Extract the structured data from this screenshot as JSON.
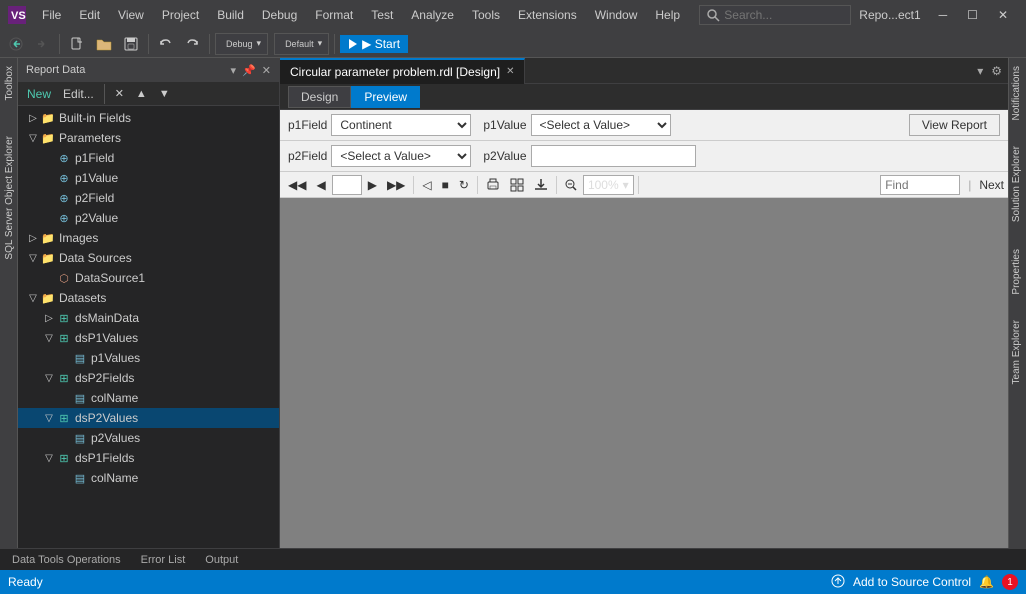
{
  "title_bar": {
    "logo_label": "VS",
    "menu_items": [
      "File",
      "Edit",
      "View",
      "Project",
      "Build",
      "Debug",
      "Format",
      "Test",
      "Analyze",
      "Tools",
      "Extensions",
      "Window",
      "Help"
    ],
    "search_placeholder": "Search...",
    "repo_label": "Repo...ect1",
    "window_controls": [
      "─",
      "☐",
      "✕"
    ]
  },
  "toolbar": {
    "back_btn": "◀",
    "forward_btn": "▶",
    "debug_label": "Debug",
    "platform_label": "Default",
    "start_btn": "▶ Start",
    "undo_btn": "↩",
    "redo_btn": "↪"
  },
  "sidebar": {
    "title": "Report Data",
    "header_pins": [
      "▾",
      "📌",
      "─"
    ],
    "toolbar_btns": [
      "New",
      "Edit...",
      "✕",
      "▲",
      "▼"
    ],
    "tree": [
      {
        "id": "built-in",
        "label": "Built-in Fields",
        "level": 0,
        "expand": "▷",
        "icon": "folder",
        "type": "folder"
      },
      {
        "id": "parameters",
        "label": "Parameters",
        "level": 0,
        "expand": "▽",
        "icon": "folder",
        "type": "folder"
      },
      {
        "id": "p1field",
        "label": "p1Field",
        "level": 1,
        "expand": "",
        "icon": "param",
        "type": "param"
      },
      {
        "id": "p1value",
        "label": "p1Value",
        "level": 1,
        "expand": "",
        "icon": "param",
        "type": "param"
      },
      {
        "id": "p2field",
        "label": "p2Field",
        "level": 1,
        "expand": "",
        "icon": "param",
        "type": "param"
      },
      {
        "id": "p2value",
        "label": "p2Value",
        "level": 1,
        "expand": "",
        "icon": "param",
        "type": "param"
      },
      {
        "id": "images",
        "label": "Images",
        "level": 0,
        "expand": "▷",
        "icon": "folder",
        "type": "folder"
      },
      {
        "id": "datasources",
        "label": "Data Sources",
        "level": 0,
        "expand": "▽",
        "icon": "folder",
        "type": "folder"
      },
      {
        "id": "datasource1",
        "label": "DataSource1",
        "level": 1,
        "expand": "",
        "icon": "datasource",
        "type": "datasource"
      },
      {
        "id": "datasets",
        "label": "Datasets",
        "level": 0,
        "expand": "▽",
        "icon": "folder",
        "type": "folder"
      },
      {
        "id": "dsmaindata",
        "label": "dsMainData",
        "level": 1,
        "expand": "▷",
        "icon": "dataset",
        "type": "dataset"
      },
      {
        "id": "dsp1values",
        "label": "dsP1Values",
        "level": 1,
        "expand": "▽",
        "icon": "dataset",
        "type": "dataset"
      },
      {
        "id": "p1values_field",
        "label": "p1Values",
        "level": 2,
        "expand": "",
        "icon": "field",
        "type": "field"
      },
      {
        "id": "dsp2fields",
        "label": "dsP2Fields",
        "level": 1,
        "expand": "▽",
        "icon": "dataset",
        "type": "dataset"
      },
      {
        "id": "colname1",
        "label": "colName",
        "level": 2,
        "expand": "",
        "icon": "field",
        "type": "field"
      },
      {
        "id": "dsp2values",
        "label": "dsP2Values",
        "level": 1,
        "expand": "▽",
        "icon": "dataset",
        "type": "dataset",
        "selected": true
      },
      {
        "id": "p2values_field",
        "label": "p2Values",
        "level": 2,
        "expand": "",
        "icon": "field",
        "type": "field"
      },
      {
        "id": "dsp1fields",
        "label": "dsP1Fields",
        "level": 1,
        "expand": "▽",
        "icon": "dataset",
        "type": "dataset"
      },
      {
        "id": "colname2",
        "label": "colName",
        "level": 2,
        "expand": "",
        "icon": "field",
        "type": "field"
      }
    ]
  },
  "editor": {
    "tab_label": "Circular parameter problem.rdl [Design]",
    "tab_close": "✕",
    "design_btn": "Design",
    "preview_btn": "Preview"
  },
  "params": {
    "p1field_label": "p1Field",
    "p1field_value": "Continent",
    "p1value_label": "p1Value",
    "p1value_placeholder": "<Select a Value>",
    "p2field_label": "p2Field",
    "p2field_placeholder": "<Select a Value>",
    "p2value_label": "p2Value",
    "p2value_value": "",
    "view_report_btn": "View Report"
  },
  "report_toolbar": {
    "nav_first": "◀◀",
    "nav_prev": "◀",
    "nav_next": "▶",
    "nav_last": "▶▶",
    "nav_back": "◁",
    "nav_stop": "■",
    "nav_refresh": "↻",
    "print": "🖨",
    "layout": "▦",
    "export": "⬇",
    "zoom_value": "100%",
    "find_placeholder": "Find",
    "find_next": "Next"
  },
  "right_panels": [
    "Notifications",
    "Solution Explorer",
    "Properties",
    "Team Explorer"
  ],
  "left_panels": [
    "Toolbox",
    "SQL Server Object Explorer"
  ],
  "bottom_tabs": [
    "Data Tools Operations",
    "Error List",
    "Output"
  ],
  "status_bar": {
    "ready": "Ready",
    "source_control": "Add to Source Control",
    "notification_icon": "🔔",
    "notification_count": "1"
  }
}
